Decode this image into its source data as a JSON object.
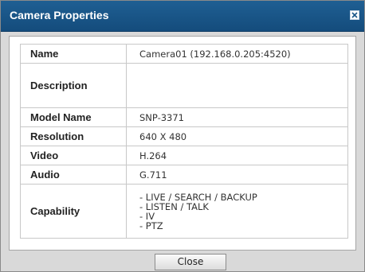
{
  "dialog": {
    "title": "Camera Properties",
    "close_button_label": "Close"
  },
  "properties": {
    "name": {
      "label": "Name",
      "value": "Camera01 (192.168.0.205:4520)"
    },
    "description": {
      "label": "Description",
      "value": ""
    },
    "model_name": {
      "label": "Model Name",
      "value": "SNP-3371"
    },
    "resolution": {
      "label": "Resolution",
      "value": "640 X 480"
    },
    "video": {
      "label": "Video",
      "value": "H.264"
    },
    "audio": {
      "label": "Audio",
      "value": "G.711"
    },
    "capability": {
      "label": "Capability",
      "items": [
        "- LIVE / SEARCH / BACKUP",
        "- LISTEN / TALK",
        "- IV",
        "- PTZ"
      ]
    }
  },
  "colors": {
    "titlebar": "#1a5688",
    "dialog_background": "#d9d9d9",
    "panel_background": "#ffffff",
    "border": "#c8c8c8"
  }
}
